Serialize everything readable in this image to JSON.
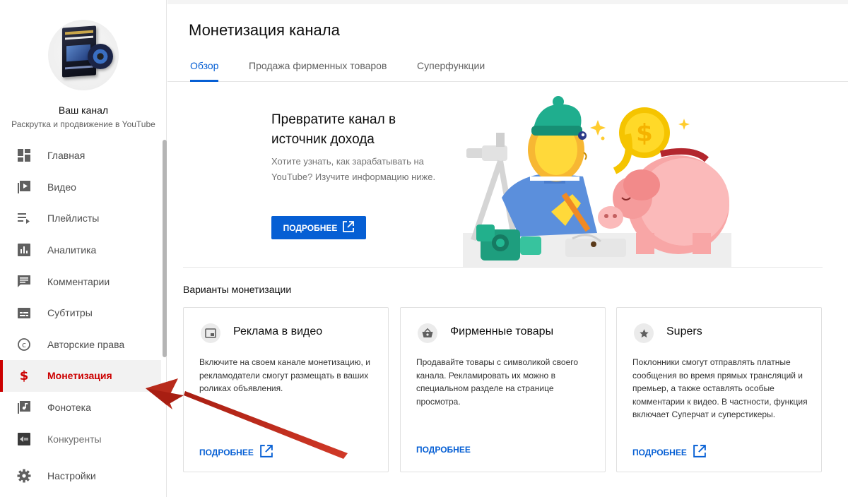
{
  "sidebar": {
    "channel_title": "Ваш канал",
    "channel_subtitle": "Раскрутка и продвижение в YouTube",
    "items": [
      {
        "label": "Главная",
        "icon": "dashboard-icon"
      },
      {
        "label": "Видео",
        "icon": "video-library-icon"
      },
      {
        "label": "Плейлисты",
        "icon": "playlist-icon"
      },
      {
        "label": "Аналитика",
        "icon": "analytics-icon"
      },
      {
        "label": "Комментарии",
        "icon": "comments-icon"
      },
      {
        "label": "Субтитры",
        "icon": "subtitles-icon"
      },
      {
        "label": "Авторские права",
        "icon": "copyright-icon"
      },
      {
        "label": "Монетизация",
        "icon": "dollar-icon",
        "active": true
      },
      {
        "label": "Фонотека",
        "icon": "audio-library-icon"
      },
      {
        "label": "Конкуренты",
        "icon": "competitors-icon"
      }
    ],
    "settings_label": "Настройки"
  },
  "main": {
    "title": "Монетизация канала",
    "tabs": [
      {
        "label": "Обзор",
        "active": true
      },
      {
        "label": "Продажа фирменных товаров"
      },
      {
        "label": "Суперфункции"
      }
    ],
    "hero": {
      "title": "Превратите канал в источник дохода",
      "description": "Хотите узнать, как зарабатывать на YouTube? Изучите информацию ниже.",
      "button_label": "ПОДРОБНЕЕ"
    },
    "section_title": "Варианты монетизации",
    "cards": [
      {
        "icon": "ad-video-icon",
        "title": "Реклама в видео",
        "description": "Включите на своем канале монетизацию, и рекламодатели смогут размещать в ваших роликах объявления.",
        "link_label": "ПОДРОБНЕЕ",
        "external": true
      },
      {
        "icon": "shopping-basket-icon",
        "title": "Фирменные товары",
        "description": "Продавайте товары с символикой своего канала. Рекламировать их можно в специальном разделе на странице просмотра.",
        "link_label": "ПОДРОБНЕЕ",
        "external": false
      },
      {
        "icon": "star-icon",
        "title": "Supers",
        "description": "Поклонники смогут отправлять платные сообщения во время прямых трансляций и премьер, а также оставлять особые комментарии к видео. В частности, функция включает Суперчат и суперстикеры.",
        "link_label": "ПОДРОБНЕЕ",
        "external": true
      }
    ]
  },
  "colors": {
    "accent_blue": "#065fd4",
    "active_red": "#cc0000",
    "annotation_arrow": "#c0392b"
  }
}
